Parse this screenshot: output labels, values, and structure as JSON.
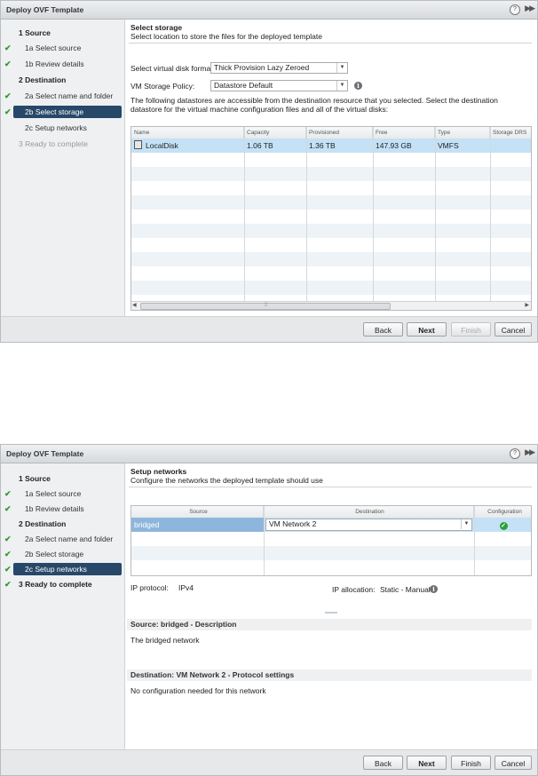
{
  "dialog1": {
    "title": "Deploy OVF Template",
    "steps": [
      {
        "label": "1  Source",
        "check": false
      },
      {
        "label": "1a  Select source",
        "check": true
      },
      {
        "label": "1b  Review details",
        "check": true
      },
      {
        "label": "2  Destination",
        "check": false
      },
      {
        "label": "2a  Select name and folder",
        "check": true
      },
      {
        "label": "2b  Select storage",
        "check": true
      },
      {
        "label": "2c  Setup networks",
        "check": false
      },
      {
        "label": "3  Ready to complete",
        "check": false
      }
    ],
    "section_title": "Select storage",
    "section_subtitle": "Select location to store the files for the deployed template",
    "disk_format_label": "Select virtual disk format:",
    "disk_format_value": "Thick Provision Lazy Zeroed",
    "storage_policy_label": "VM Storage Policy:",
    "storage_policy_value": "Datastore Default",
    "note": "The following datastores are accessible from the destination resource that you selected. Select the destination datastore for the virtual machine configuration files and all of the virtual disks:",
    "table": {
      "columns": [
        "Name",
        "Capacity",
        "Provisioned",
        "Free",
        "Type",
        "Storage DRS"
      ],
      "rows": [
        {
          "name": "LocalDisk",
          "capacity": "1.06 TB",
          "provisioned": "1.36 TB",
          "free": "147.93 GB",
          "type": "VMFS",
          "storage_drs": ""
        }
      ]
    },
    "buttons": {
      "back": "Back",
      "next": "Next",
      "finish": "Finish",
      "cancel": "Cancel"
    }
  },
  "dialog2": {
    "title": "Deploy OVF Template",
    "steps": [
      {
        "label": "1  Source",
        "check": false
      },
      {
        "label": "1a  Select source",
        "check": true
      },
      {
        "label": "1b  Review details",
        "check": true
      },
      {
        "label": "2  Destination",
        "check": false
      },
      {
        "label": "2a  Select name and folder",
        "check": true
      },
      {
        "label": "2b  Select storage",
        "check": true
      },
      {
        "label": "2c  Setup networks",
        "check": true
      },
      {
        "label": "3  Ready to complete",
        "check": true
      }
    ],
    "section_title": "Setup networks",
    "section_subtitle": "Configure the networks the deployed template should use",
    "table": {
      "columns": [
        "Source",
        "Destination",
        "Configuration"
      ],
      "rows": [
        {
          "source": "bridged",
          "destination": "VM Network 2",
          "configuration": "ok"
        }
      ]
    },
    "ip_protocol_label": "IP protocol:",
    "ip_protocol_value": "IPv4",
    "ip_allocation_label": "IP allocation:",
    "ip_allocation_value": "Static - Manual",
    "source_desc_title": "Source: bridged - Description",
    "source_desc_text": "The bridged network",
    "dest_title": "Destination: VM Network 2 - Protocol settings",
    "dest_text": "No configuration needed for this network",
    "buttons": {
      "back": "Back",
      "next": "Next",
      "finish": "Finish",
      "cancel": "Cancel"
    }
  },
  "colors": {
    "active_step": "#274868",
    "selected_row": "#c4e1f6",
    "check": "#2e9a2e"
  },
  "icons": [
    "help-icon",
    "expand-icon",
    "check-icon",
    "info-icon",
    "dropdown-arrow-icon",
    "datastore-icon",
    "ok-status-icon"
  ]
}
